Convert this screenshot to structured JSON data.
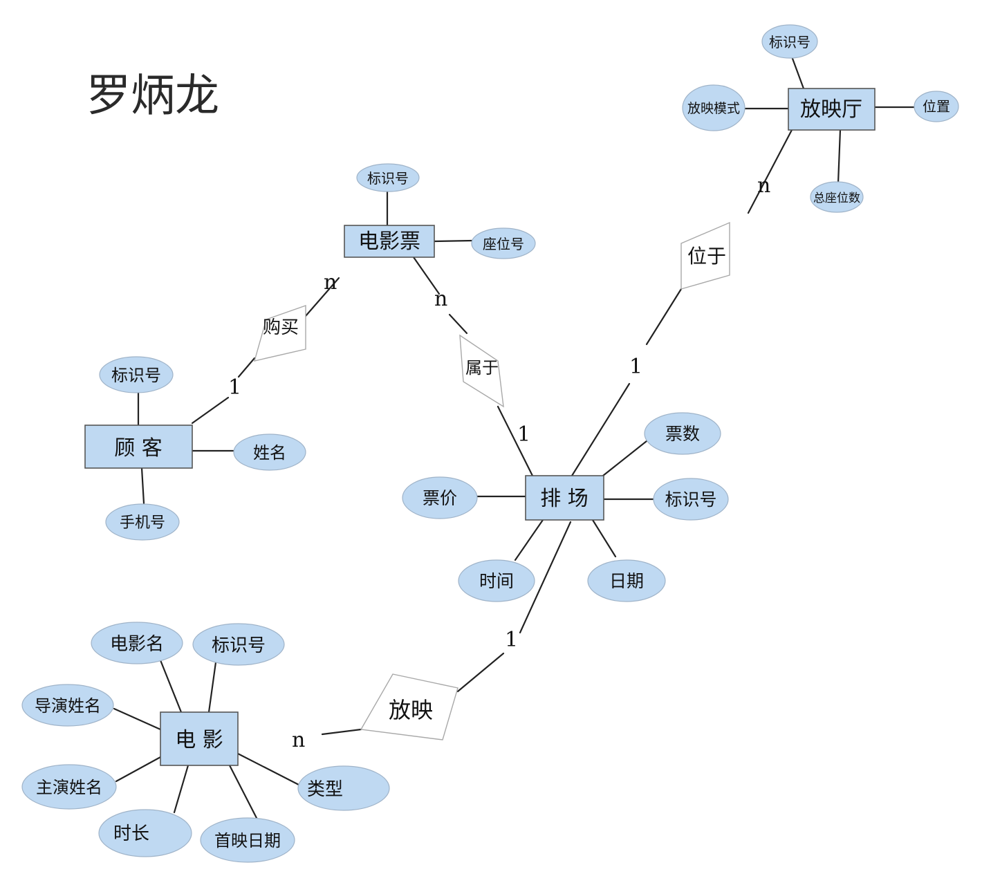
{
  "author": "罗炳龙",
  "entities": {
    "customer": {
      "label": "顾 客",
      "attributes": {
        "id": "标识号",
        "name": "姓名",
        "phone": "手机号"
      }
    },
    "ticket": {
      "label": "电影票",
      "attributes": {
        "id": "标识号",
        "seat": "座位号"
      }
    },
    "hall": {
      "label": "放映厅",
      "attributes": {
        "id": "标识号",
        "mode": "放映模式",
        "location": "位置",
        "seats": "总座位数"
      }
    },
    "schedule": {
      "label": "排 场",
      "attributes": {
        "count": "票数",
        "price": "票价",
        "id": "标识号",
        "time": "时间",
        "date": "日期"
      }
    },
    "movie": {
      "label": "电 影",
      "attributes": {
        "name": "电影名",
        "id": "标识号",
        "director": "导演姓名",
        "actor": "主演姓名",
        "type": "类型",
        "duration": "时长",
        "premiere": "首映日期"
      }
    }
  },
  "relationships": {
    "buy": {
      "label": "购买",
      "card_customer": "1",
      "card_ticket": "n"
    },
    "belong": {
      "label": "属于",
      "card_ticket": "n",
      "card_schedule": "1"
    },
    "in": {
      "label": "位于",
      "card_hall": "n",
      "card_schedule": "1"
    },
    "show": {
      "label": "放映",
      "card_movie": "n",
      "card_schedule": "1"
    }
  }
}
